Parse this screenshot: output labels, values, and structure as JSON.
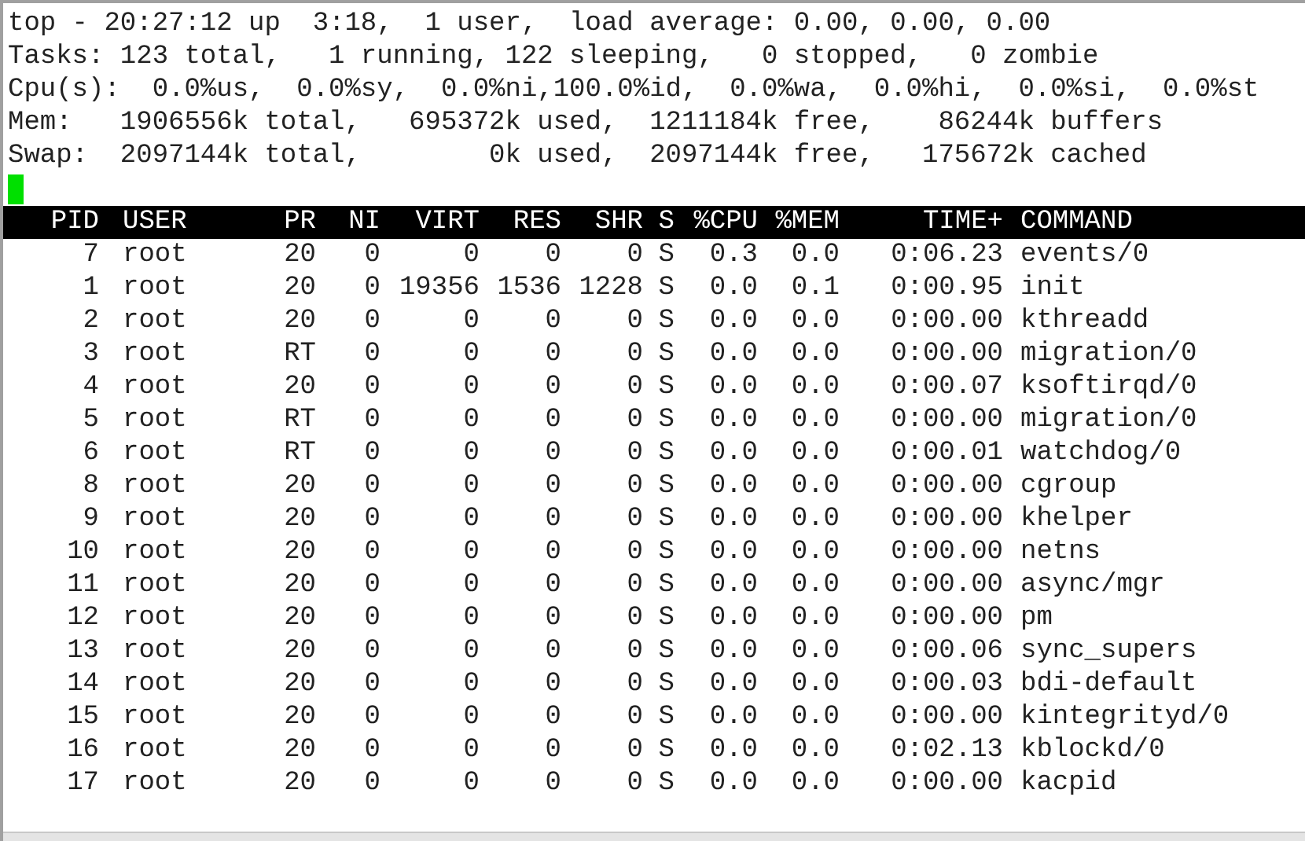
{
  "summary": [
    "top - 20:27:12 up  3:18,  1 user,  load average: 0.00, 0.00, 0.00",
    "Tasks: 123 total,   1 running, 122 sleeping,   0 stopped,   0 zombie",
    "Cpu(s):  0.0%us,  0.0%sy,  0.0%ni,100.0%id,  0.0%wa,  0.0%hi,  0.0%si,  0.0%st",
    "Mem:   1906556k total,   695372k used,  1211184k free,    86244k buffers",
    "Swap:  2097144k total,        0k used,  2097144k free,   175672k cached"
  ],
  "columns": [
    "PID",
    "USER",
    "PR",
    "NI",
    "VIRT",
    "RES",
    "SHR",
    "S",
    "%CPU",
    "%MEM",
    "TIME+",
    "COMMAND"
  ],
  "rows": [
    [
      "7",
      "root",
      "20",
      "0",
      "0",
      "0",
      "0",
      "S",
      "0.3",
      "0.0",
      "0:06.23",
      "events/0"
    ],
    [
      "1",
      "root",
      "20",
      "0",
      "19356",
      "1536",
      "1228",
      "S",
      "0.0",
      "0.1",
      "0:00.95",
      "init"
    ],
    [
      "2",
      "root",
      "20",
      "0",
      "0",
      "0",
      "0",
      "S",
      "0.0",
      "0.0",
      "0:00.00",
      "kthreadd"
    ],
    [
      "3",
      "root",
      "RT",
      "0",
      "0",
      "0",
      "0",
      "S",
      "0.0",
      "0.0",
      "0:00.00",
      "migration/0"
    ],
    [
      "4",
      "root",
      "20",
      "0",
      "0",
      "0",
      "0",
      "S",
      "0.0",
      "0.0",
      "0:00.07",
      "ksoftirqd/0"
    ],
    [
      "5",
      "root",
      "RT",
      "0",
      "0",
      "0",
      "0",
      "S",
      "0.0",
      "0.0",
      "0:00.00",
      "migration/0"
    ],
    [
      "6",
      "root",
      "RT",
      "0",
      "0",
      "0",
      "0",
      "S",
      "0.0",
      "0.0",
      "0:00.01",
      "watchdog/0"
    ],
    [
      "8",
      "root",
      "20",
      "0",
      "0",
      "0",
      "0",
      "S",
      "0.0",
      "0.0",
      "0:00.00",
      "cgroup"
    ],
    [
      "9",
      "root",
      "20",
      "0",
      "0",
      "0",
      "0",
      "S",
      "0.0",
      "0.0",
      "0:00.00",
      "khelper"
    ],
    [
      "10",
      "root",
      "20",
      "0",
      "0",
      "0",
      "0",
      "S",
      "0.0",
      "0.0",
      "0:00.00",
      "netns"
    ],
    [
      "11",
      "root",
      "20",
      "0",
      "0",
      "0",
      "0",
      "S",
      "0.0",
      "0.0",
      "0:00.00",
      "async/mgr"
    ],
    [
      "12",
      "root",
      "20",
      "0",
      "0",
      "0",
      "0",
      "S",
      "0.0",
      "0.0",
      "0:00.00",
      "pm"
    ],
    [
      "13",
      "root",
      "20",
      "0",
      "0",
      "0",
      "0",
      "S",
      "0.0",
      "0.0",
      "0:00.06",
      "sync_supers"
    ],
    [
      "14",
      "root",
      "20",
      "0",
      "0",
      "0",
      "0",
      "S",
      "0.0",
      "0.0",
      "0:00.03",
      "bdi-default"
    ],
    [
      "15",
      "root",
      "20",
      "0",
      "0",
      "0",
      "0",
      "S",
      "0.0",
      "0.0",
      "0:00.00",
      "kintegrityd/0"
    ],
    [
      "16",
      "root",
      "20",
      "0",
      "0",
      "0",
      "0",
      "S",
      "0.0",
      "0.0",
      "0:02.13",
      "kblockd/0"
    ],
    [
      "17",
      "root",
      "20",
      "0",
      "0",
      "0",
      "0",
      "S",
      "0.0",
      "0.0",
      "0:00.00",
      "kacpid"
    ]
  ]
}
